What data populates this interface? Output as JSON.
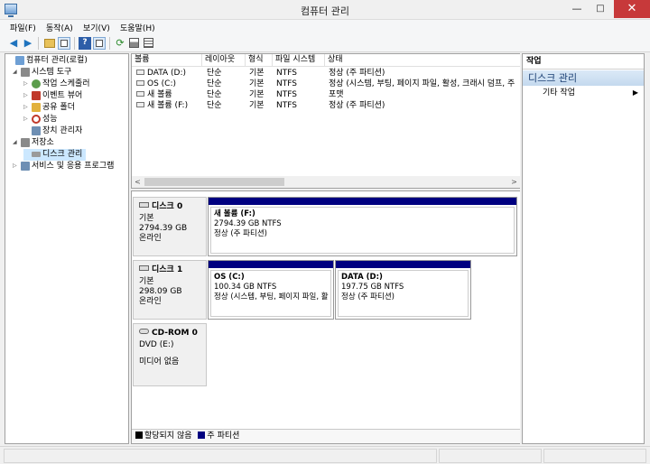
{
  "window": {
    "title": "컴퓨터 관리",
    "minimize": "—",
    "maximize": "□",
    "close": "✕"
  },
  "menu": [
    "파일(F)",
    "동작(A)",
    "보기(V)",
    "도움말(H)"
  ],
  "toolbar": {
    "buttons": [
      "back-icon",
      "forward-icon",
      "up-folder-icon",
      "show-tree-icon",
      "help-icon",
      "show-action-pane-icon",
      "refresh-icon",
      "properties-icon",
      "export-icon"
    ],
    "glyphs": {
      "back": "◀",
      "forward": "▶",
      "help": "?",
      "refresh": "⟳"
    }
  },
  "tree": [
    {
      "label": "컴퓨터 관리(로컬)",
      "level": 0,
      "exp": "",
      "icon": "computer-icon",
      "color": "#6e9fd4"
    },
    {
      "label": "시스템 도구",
      "level": 1,
      "exp": "◢",
      "icon": "tools-icon",
      "color": "#8a8a8a"
    },
    {
      "label": "작업 스케줄러",
      "level": 2,
      "exp": "▷",
      "icon": "clock-icon",
      "color": "#5b9d4c"
    },
    {
      "label": "이벤트 뷰어",
      "level": 2,
      "exp": "▷",
      "icon": "event-viewer-icon",
      "color": "#c0392b"
    },
    {
      "label": "공유 폴더",
      "level": 2,
      "exp": "▷",
      "icon": "shared-folder-icon",
      "color": "#e2b13c"
    },
    {
      "label": "성능",
      "level": 2,
      "exp": "▷",
      "icon": "performance-icon",
      "color": "#c0392b"
    },
    {
      "label": "장치 관리자",
      "level": 2,
      "exp": "",
      "icon": "device-manager-icon",
      "color": "#6e8fb4"
    },
    {
      "label": "저장소",
      "level": 1,
      "exp": "◢",
      "icon": "storage-icon",
      "color": "#8a8a8a"
    },
    {
      "label": "디스크 관리",
      "level": 2,
      "exp": "",
      "icon": "disk-icon",
      "color": "#9a9a9a",
      "selected": true
    },
    {
      "label": "서비스 및 응용 프로그램",
      "level": 1,
      "exp": "▷",
      "icon": "services-icon",
      "color": "#6e8fb4"
    }
  ],
  "volumes": {
    "columns": [
      "볼륨",
      "레이아웃",
      "형식",
      "파일 시스템",
      "상태"
    ],
    "rows": [
      [
        "DATA (D:)",
        "단순",
        "기본",
        "NTFS",
        "정상 (주 파티션)"
      ],
      [
        "OS (C:)",
        "단순",
        "기본",
        "NTFS",
        "정상 (시스템, 부팅, 페이지 파일, 활성, 크래시 덤프, 주"
      ],
      [
        "새 볼륨",
        "단순",
        "기본",
        "NTFS",
        "포맷"
      ],
      [
        "새 볼륨 (F:)",
        "단순",
        "기본",
        "NTFS",
        "정상 (주 파티션)"
      ]
    ],
    "scroll_left": "<",
    "scroll_right": ">"
  },
  "disks": [
    {
      "name": "디스크 0",
      "type": "기본",
      "size": "2794.39 GB",
      "status": "온라인",
      "partitions": [
        {
          "name": "새 볼륨  (F:)",
          "size": "2794.39 GB NTFS",
          "status": "정상 (주 파티션)"
        }
      ]
    },
    {
      "name": "디스크 1",
      "type": "기본",
      "size": "298.09 GB",
      "status": "온라인",
      "partitions": [
        {
          "name": "OS  (C:)",
          "size": "100.34 GB NTFS",
          "status": "정상 (시스템, 부팅, 페이지 파일, 활"
        },
        {
          "name": "DATA  (D:)",
          "size": "197.75 GB NTFS",
          "status": "정상 (주 파티션)"
        }
      ]
    },
    {
      "name": "CD-ROM 0",
      "type": "DVD (E:)",
      "size": "",
      "status": "미디어 없음",
      "partitions": []
    }
  ],
  "legend": [
    {
      "label": "할당되지 않음",
      "color": "#000000"
    },
    {
      "label": "주 파티션",
      "color": "#000080"
    }
  ],
  "actions": {
    "header": "작업",
    "section": "디스크 관리",
    "items": [
      {
        "label": "기타 작업",
        "arrow": "▶"
      }
    ]
  }
}
